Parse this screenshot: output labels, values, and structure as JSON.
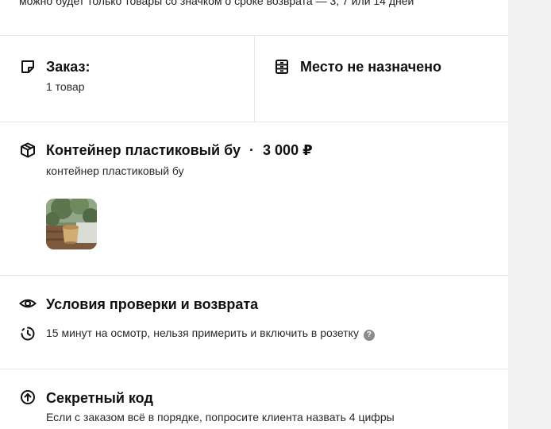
{
  "top_notice": "можно будет только товары со значком о сроке возврата — 3, 7 или 14 дней",
  "order": {
    "title": "Заказ:",
    "count": "1 товар",
    "place": "Место не назначено"
  },
  "item": {
    "name": "Контейнер пластиковый бу",
    "separator": "·",
    "price": "3 000 ₽",
    "description": "контейнер пластиковый бу",
    "thumbnail_alt": "фото товара"
  },
  "inspection": {
    "title": "Условия проверки и возврата",
    "text": "15 минут на осмотр, нельзя примерить и включить в розетку",
    "help": "?"
  },
  "secret": {
    "title": "Секретный код",
    "text": "Если с заказом всё в порядке, попросите клиента назвать 4 цифры"
  },
  "icons": {
    "order": "sticker-note-icon",
    "place": "cabinet-icon",
    "item": "box-icon",
    "inspection": "eye-icon",
    "timer": "timer-icon",
    "secret": "arrow-up-circle-icon"
  },
  "colors": {
    "panel": "#ffffff",
    "background": "#f2f2f2",
    "divider": "#e6e6e6",
    "help": "#8c8c8c"
  }
}
